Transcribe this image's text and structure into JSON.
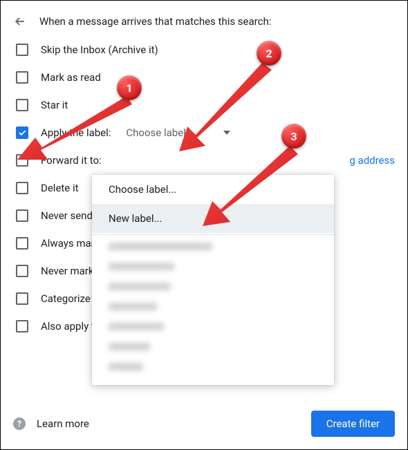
{
  "header": {
    "title": "When a message arrives that matches this search:"
  },
  "options": {
    "skip_inbox": "Skip the Inbox (Archive it)",
    "mark_read": "Mark as read",
    "star_it": "Star it",
    "apply_label": "Apply the label:",
    "choose_label": "Choose label...",
    "forward_to": "Forward it to:",
    "add_address": "Add forwarding address",
    "delete_it": "Delete it",
    "never_spam": "Never send it to Spam",
    "always_important": "Always mark it as important",
    "never_important": "Never mark it as important",
    "categorize": "Categorize as:",
    "also_apply": "Also apply filter to matching conversations."
  },
  "footer": {
    "learn_more": "Learn more",
    "create_filter": "Create filter"
  },
  "dropdown": {
    "choose": "Choose label...",
    "new_label": "New label..."
  },
  "badges": {
    "b1": "1",
    "b2": "2",
    "b3": "3"
  }
}
